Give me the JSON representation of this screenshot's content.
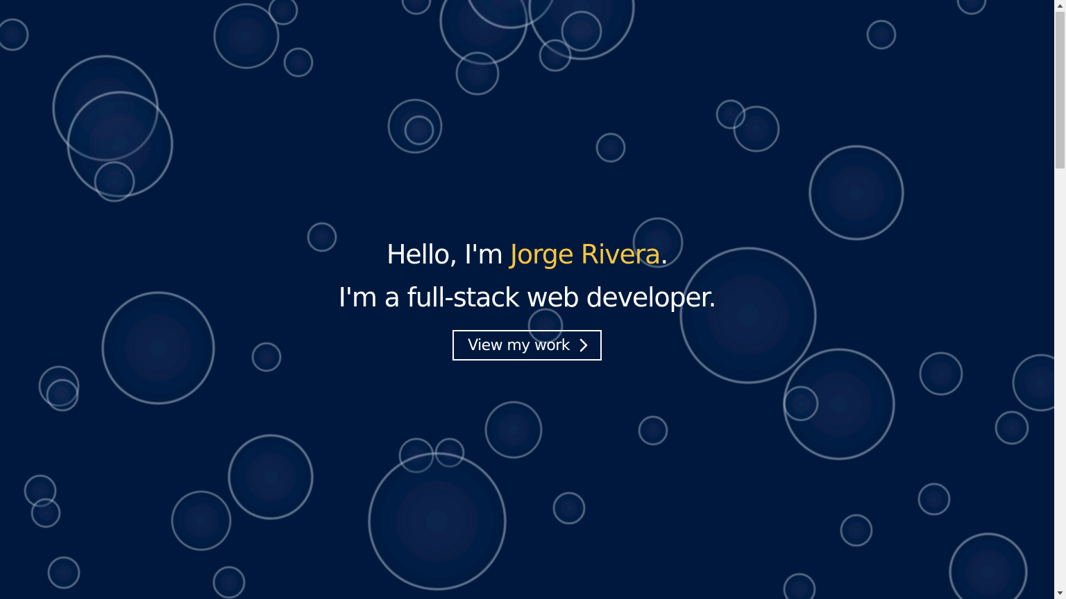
{
  "hero": {
    "greeting_prefix": "Hello, I'm ",
    "name": "Jorge Rivera",
    "greeting_suffix": ".",
    "tagline": "I'm a full-stack web developer.",
    "cta_label": "View my work",
    "cta_icon": "chevron-right-icon"
  },
  "colors": {
    "background": "#00183d",
    "text": "#ffffff",
    "accent": "#f5c542",
    "bubble_ring": "#a9b8cf"
  }
}
